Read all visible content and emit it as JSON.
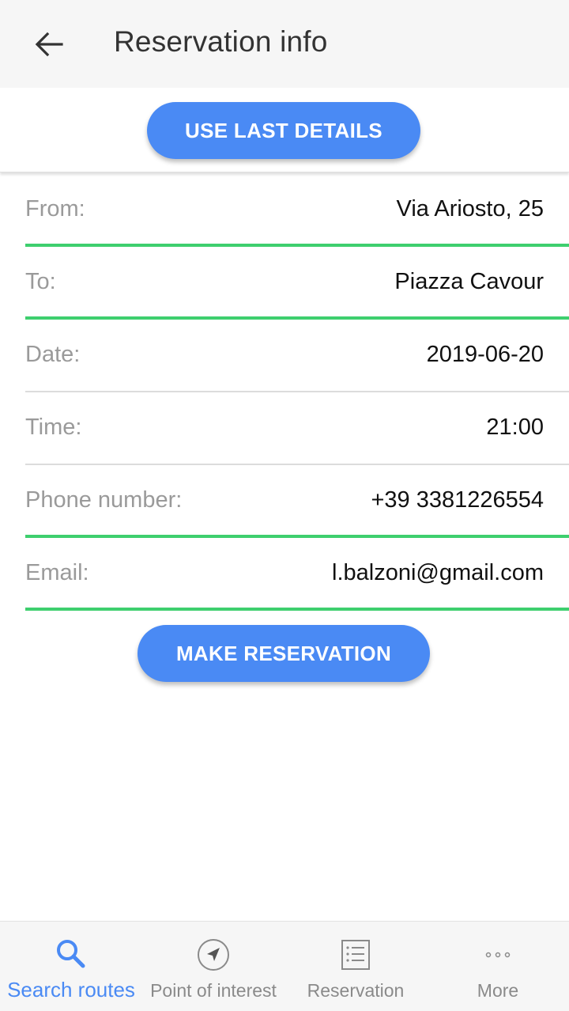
{
  "header": {
    "title": "Reservation info",
    "back_icon": "arrow-left-icon"
  },
  "actions": {
    "use_last_details": "USE LAST DETAILS",
    "make_reservation": "MAKE RESERVATION"
  },
  "form": {
    "rows": [
      {
        "label": "From:",
        "value": "Via Ariosto, 25"
      },
      {
        "label": "To:",
        "value": "Piazza Cavour"
      },
      {
        "label": "Date:",
        "value": "2019-06-20"
      },
      {
        "label": "Time:",
        "value": "21:00"
      },
      {
        "label": "Phone number:",
        "value": "+39 3381226554"
      },
      {
        "label": "Email:",
        "value": "l.balzoni@gmail.com"
      }
    ]
  },
  "bottom_nav": {
    "items": [
      {
        "label": "Search routes",
        "icon": "search-icon",
        "active": true
      },
      {
        "label": "Point of interest",
        "icon": "compass-icon",
        "active": false
      },
      {
        "label": "Reservation",
        "icon": "list-icon",
        "active": false
      },
      {
        "label": "More",
        "icon": "more-icon",
        "active": false
      }
    ]
  },
  "colors": {
    "accent": "#4a8af4",
    "valid_underline": "#3ecf6e",
    "header_bg": "#f6f6f6"
  }
}
